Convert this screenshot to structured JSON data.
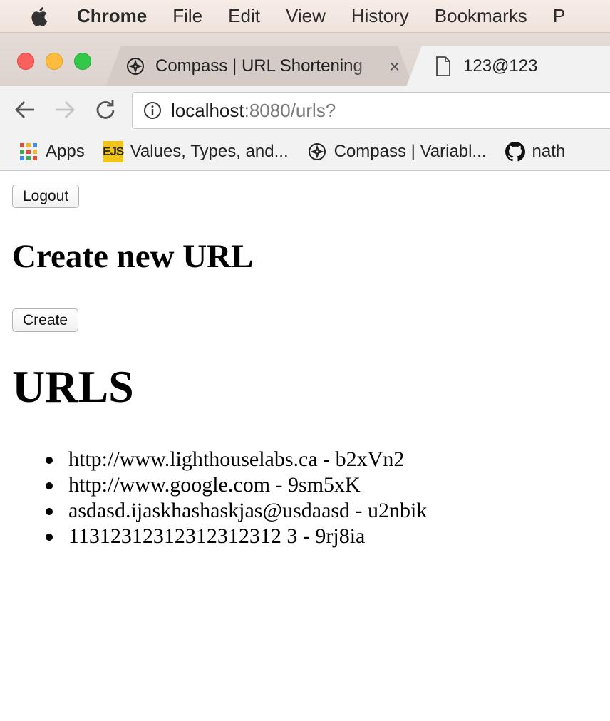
{
  "menubar": {
    "app_name": "Chrome",
    "items": [
      "File",
      "Edit",
      "View",
      "History",
      "Bookmarks",
      "P"
    ]
  },
  "tabs": [
    {
      "title": "Compass | URL Shortening",
      "icon": "compass-icon",
      "active": false
    },
    {
      "title": "123@123",
      "icon": "document-icon",
      "active": true
    }
  ],
  "tab_close_glyph": "×",
  "address": {
    "host": "localhost",
    "rest": ":8080/urls?"
  },
  "bookmarks": [
    {
      "label": "Apps",
      "icon": "apps-grid-icon"
    },
    {
      "label": "Values, Types, and...",
      "icon": "ejs-icon",
      "icon_text": "EJS"
    },
    {
      "label": "Compass | Variabl...",
      "icon": "compass-icon"
    },
    {
      "label": "nath",
      "icon": "github-icon"
    }
  ],
  "page": {
    "logout_label": "Logout",
    "create_heading": "Create new URL",
    "create_label": "Create",
    "urls_heading": "URLS",
    "urls": [
      "http://www.lighthouselabs.ca - b2xVn2",
      "http://www.google.com - 9sm5xK",
      "asdasd.ijaskhashaskjas@usdaasd - u2nbik",
      "11312312312312312312 3 - 9rj8ia"
    ]
  },
  "colors": {
    "traffic_close": "#fc605c",
    "traffic_minimize": "#fdbc40",
    "traffic_maximize": "#34c84a",
    "ejs_badge": "#f0c419"
  }
}
